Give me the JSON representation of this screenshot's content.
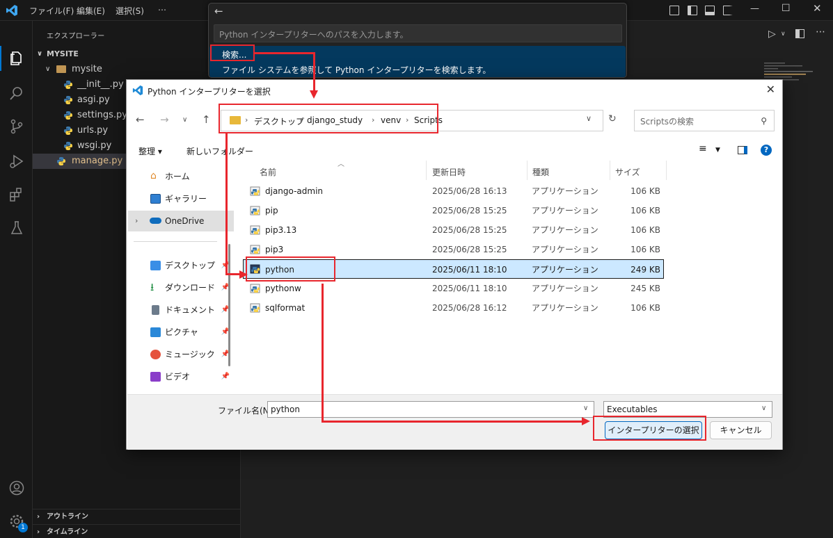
{
  "titlebar": {
    "menu": [
      "ファイル(F)",
      "編集(E)",
      "選択(S)",
      "⋯"
    ]
  },
  "sidebar": {
    "title": "エクスプローラー",
    "root": "MYSITE",
    "folder": "mysite",
    "files": [
      "__init__.py",
      "asgi.py",
      "settings.py",
      "urls.py",
      "wsgi.py"
    ],
    "selected_file": "manage.py",
    "sections": [
      "アウトライン",
      "タイムライン"
    ]
  },
  "notification_badge": "1",
  "quickinput": {
    "placeholder": "Python インタープリターへのパスを入力します。",
    "item_label": "検索...",
    "item_description": "ファイル システムを参照して Python インタープリターを検索します。"
  },
  "dialog": {
    "title": "Python インタープリターを選択",
    "breadcrumbs": [
      "デスクトップ",
      "django_study",
      "venv",
      "Scripts"
    ],
    "search_placeholder": "Scriptsの検索",
    "toolbar": {
      "organize": "整理 ▾",
      "new_folder": "新しいフォルダー"
    },
    "nav": {
      "home": "ホーム",
      "gallery": "ギャラリー",
      "onedrive": "OneDrive",
      "desktop": "デスクトップ",
      "downloads": "ダウンロード",
      "documents": "ドキュメント",
      "pictures": "ピクチャ",
      "music": "ミュージック",
      "videos": "ビデオ"
    },
    "columns": {
      "name": "名前",
      "date": "更新日時",
      "type": "種類",
      "size": "サイズ"
    },
    "files": [
      {
        "name": "django-admin",
        "date": "2025/06/28 16:13",
        "type": "アプリケーション",
        "size": "106 KB"
      },
      {
        "name": "pip",
        "date": "2025/06/28 15:25",
        "type": "アプリケーション",
        "size": "106 KB"
      },
      {
        "name": "pip3.13",
        "date": "2025/06/28 15:25",
        "type": "アプリケーション",
        "size": "106 KB"
      },
      {
        "name": "pip3",
        "date": "2025/06/28 15:25",
        "type": "アプリケーション",
        "size": "106 KB"
      },
      {
        "name": "python",
        "date": "2025/06/11 18:10",
        "type": "アプリケーション",
        "size": "249 KB"
      },
      {
        "name": "pythonw",
        "date": "2025/06/11 18:10",
        "type": "アプリケーション",
        "size": "245 KB"
      },
      {
        "name": "sqlformat",
        "date": "2025/06/28 16:12",
        "type": "アプリケーション",
        "size": "106 KB"
      }
    ],
    "selected_index": 4,
    "filename_label": "ファイル名(N):",
    "filename_value": "python",
    "filetype_value": "Executables",
    "ok_label": "インタープリターの選択",
    "cancel_label": "キャンセル"
  },
  "colors": {
    "accent": "#0078d4",
    "annotation": "#e8262d",
    "selection": "#cce8ff"
  }
}
